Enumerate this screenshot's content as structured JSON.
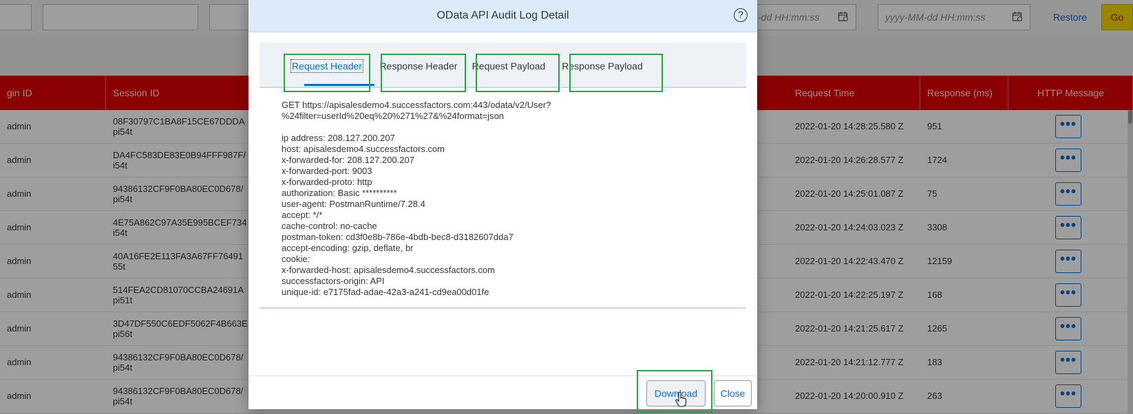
{
  "background": {
    "filter": {
      "date_placeholder_from": "-dd HH:mm:ss",
      "date_placeholder_to": "yyyy-MM-dd HH:mm:ss",
      "restore_label": "Restore",
      "go_label": "Go"
    },
    "table": {
      "headers": {
        "login_id": "gin ID",
        "session_id": "Session ID",
        "request_time": "Request Time",
        "response_ms": "Response (ms)",
        "http_message": "HTTP Message"
      },
      "rows": [
        {
          "login": "admin",
          "session": "08F30797C1BA8F15CE67DDDA",
          "suffix": "pi54t",
          "time": "2022-01-20 14:28:25.580 Z",
          "ms": "951"
        },
        {
          "login": "admin",
          "session": "DA4FC583DE83E0B94FFF987F/",
          "suffix": "i54t",
          "time": "2022-01-20 14:26:28.577 Z",
          "ms": "1724"
        },
        {
          "login": "admin",
          "session": "94386132CF9F0BA80EC0D678/",
          "suffix": "pi54t",
          "time": "2022-01-20 14:25:01.087 Z",
          "ms": "75"
        },
        {
          "login": "admin",
          "session": "4E75A862C97A35E995BCEF734",
          "suffix": "i54t",
          "time": "2022-01-20 14:24:03.023 Z",
          "ms": "3308"
        },
        {
          "login": "admin",
          "session": "40A16FE2E113FA3A67FF76491",
          "suffix": "55t",
          "time": "2022-01-20 14:22:43.470 Z",
          "ms": "12159"
        },
        {
          "login": "admin",
          "session": "514FEA2CD81070CCBA24691A",
          "suffix": "pi51t",
          "time": "2022-01-20 14:22:25.197 Z",
          "ms": "168"
        },
        {
          "login": "admin",
          "session": "3D47DF550C6EDF5062F4B663E",
          "suffix": "pi56t",
          "time": "2022-01-20 14:21:25.617 Z",
          "ms": "1265"
        },
        {
          "login": "admin",
          "session": "94386132CF9F0BA80EC0D678/",
          "suffix": "pi54t",
          "time": "2022-01-20 14:21:12.777 Z",
          "ms": "183"
        },
        {
          "login": "admin",
          "session": "94386132CF9F0BA80EC0D678/",
          "suffix": "pi54t",
          "time": "2022-01-20 14:20:00.910 Z",
          "ms": "263"
        }
      ],
      "more_label": "•••"
    }
  },
  "dialog": {
    "title": "OData API Audit Log Detail",
    "help_label": "?",
    "tabs": [
      "Request Header",
      "Response Header",
      "Request Payload",
      "Response Payload"
    ],
    "content": {
      "request_line_1": "GET https://apisalesdemo4.successfactors.com:443/odata/v2/User?",
      "request_line_2": "%24filter=userId%20eq%20%271%27&%24format=json",
      "headers": [
        "ip address: 208.127.200.207",
        "host: apisalesdemo4.successfactors.com",
        "x-forwarded-for: 208.127.200.207",
        "x-forwarded-port: 9003",
        "x-forwarded-proto: http",
        "authorization: Basic **********",
        "user-agent: PostmanRuntime/7.28.4",
        "accept: */*",
        "cache-control: no-cache",
        "postman-token: cd3f0e8b-786e-4bdb-bec8-d3182607dda7",
        "accept-encoding: gzip, deflate, br",
        "cookie:",
        "x-forwarded-host: apisalesdemo4.successfactors.com",
        "successfactors-origin: API",
        "unique-id: e7175fad-adae-42a3-a241-cd9ea00d01fe"
      ]
    },
    "footer": {
      "download_label": "Download",
      "close_label": "Close"
    }
  },
  "colors": {
    "table_header": "#e00000",
    "accent": "#0a6ed1",
    "highlight": "#28a745",
    "go_button": "#f6d700"
  }
}
